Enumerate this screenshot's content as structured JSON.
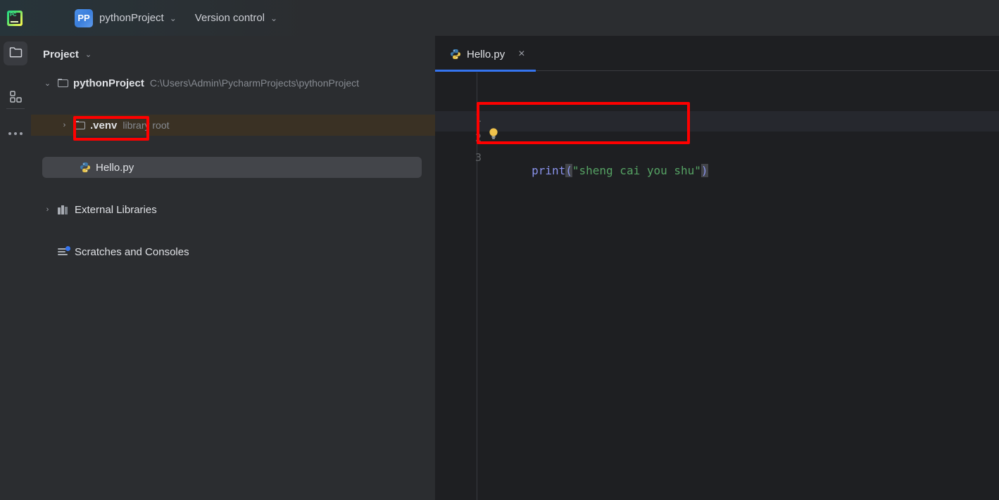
{
  "titlebar": {
    "logo_icon": "pycharm-logo-icon",
    "menu_icon": "hamburger-menu-icon",
    "project_badge": "PP",
    "project_name": "pythonProject",
    "project_chevron": "⌄",
    "vcs_label": "Version control",
    "vcs_chevron": "⌄"
  },
  "rail": {
    "items": [
      {
        "name": "project-tool-window",
        "icon": "folder-icon",
        "active": true
      },
      {
        "name": "structure-tool-window",
        "icon": "four-squares-icon",
        "active": false
      },
      {
        "name": "more-tool-windows",
        "icon": "ellipsis-icon",
        "active": false
      }
    ]
  },
  "project_panel": {
    "title": "Project",
    "chevron": "⌄",
    "tree": [
      {
        "label": "pythonProject",
        "sub": "C:\\Users\\Admin\\PycharmProjects\\pythonProject",
        "arrow": "⌄",
        "icon": "folder-icon",
        "bold": true,
        "state": "expanded"
      },
      {
        "label": ".venv",
        "sub": "library root",
        "arrow": "›",
        "icon": "folder-icon",
        "bold": true,
        "state": "collapsed",
        "highlight": "excluded"
      },
      {
        "label": "Hello.py",
        "sub": "",
        "arrow": "",
        "icon": "python-file-icon",
        "bold": false,
        "state": "leaf",
        "highlight": "selected"
      },
      {
        "label": "External Libraries",
        "sub": "",
        "arrow": "›",
        "icon": "library-icon",
        "bold": false,
        "state": "collapsed"
      },
      {
        "label": "Scratches and Consoles",
        "sub": "",
        "arrow": "",
        "icon": "scratches-icon",
        "bold": false,
        "state": "leaf"
      }
    ]
  },
  "editor": {
    "tab": {
      "label": "Hello.py",
      "icon": "python-file-icon",
      "close": "×",
      "active": true
    },
    "line_numbers": [
      "1",
      "2",
      "3"
    ],
    "active_line": 3,
    "intention_bulb_icon": "lightbulb-icon",
    "code": {
      "full_text": "print(\"sheng cai you shu\")",
      "tokens": [
        {
          "text": "print",
          "type": "function"
        },
        {
          "text": "(",
          "type": "brace-matched"
        },
        {
          "text": "\"sheng cai you shu\"",
          "type": "string"
        },
        {
          "text": ")",
          "type": "brace-matched"
        }
      ]
    }
  },
  "annotations": [
    {
      "name": "redbox-file",
      "target": "Hello.py tree item"
    },
    {
      "name": "redbox-code",
      "target": "print(\"sheng cai you shu\") code line"
    }
  ],
  "colors": {
    "accent_blue": "#3574F0",
    "panel_bg": "#2B2D30",
    "editor_bg": "#1E1F22",
    "selection": "#43454A",
    "excluded_folder": "#3A3124",
    "string_green": "#56A364",
    "function_purple": "#8A93EC",
    "annotation_red": "#FF0000",
    "bulb_amber": "#F0C24B"
  }
}
